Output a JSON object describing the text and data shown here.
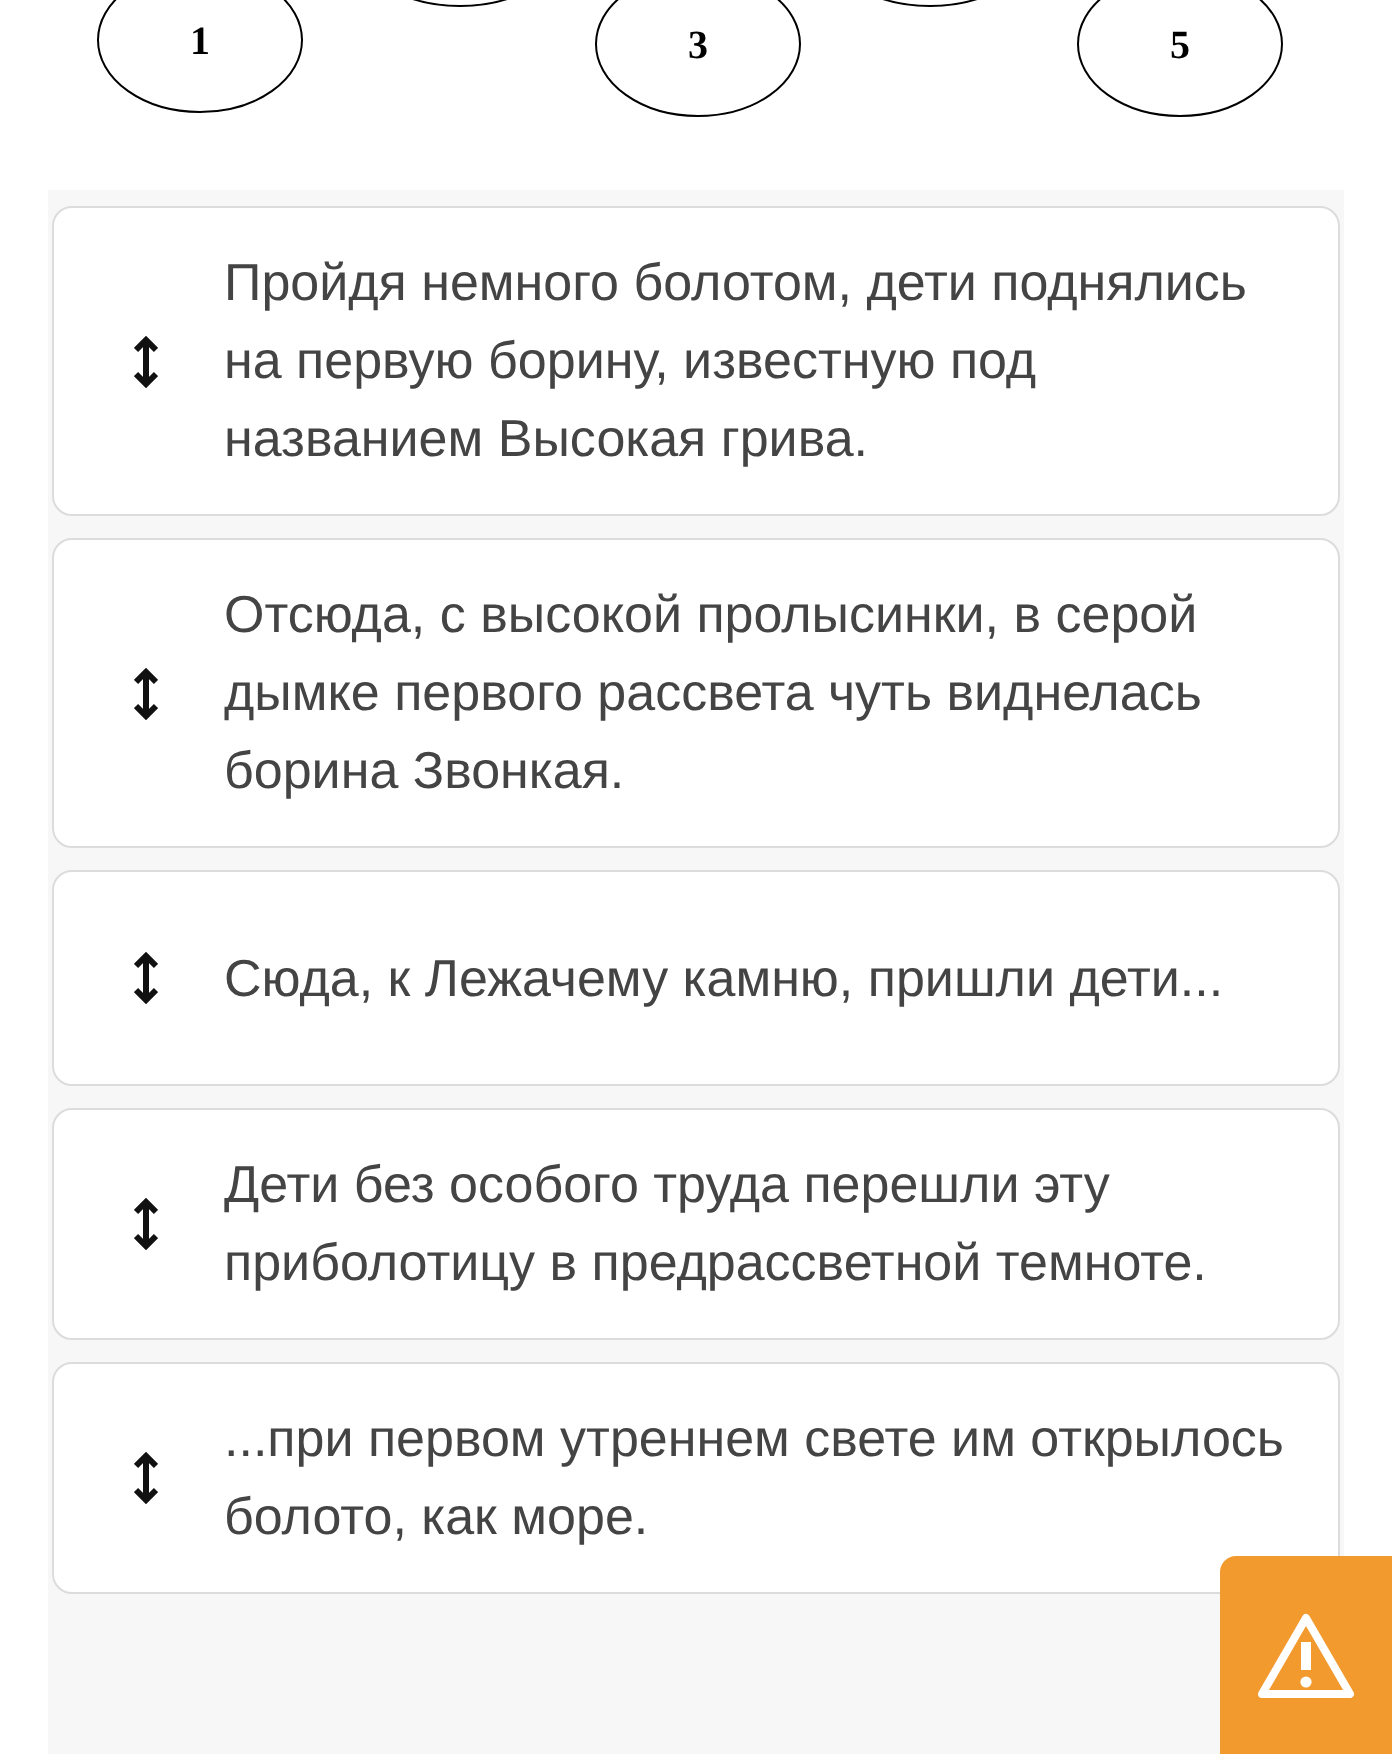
{
  "diagram": {
    "nodes": [
      {
        "label": "1"
      },
      {
        "label": "3"
      },
      {
        "label": "5"
      }
    ]
  },
  "items": [
    {
      "text": "Пройдя немного болотом, дети поднялись на первую борину, известную под названием Высокая грива."
    },
    {
      "text": "Отсюда, с высокой пролысинки, в серой дымке первого рассвета чуть виднелась борина Звонкая."
    },
    {
      "text": "Сюда, к Лежачему камню, пришли дети..."
    },
    {
      "text": "Дети без особого труда перешли эту приболотицу в предрассветной темноте."
    },
    {
      "text": "...при первом утреннем свете им открылось болото, как море."
    }
  ]
}
